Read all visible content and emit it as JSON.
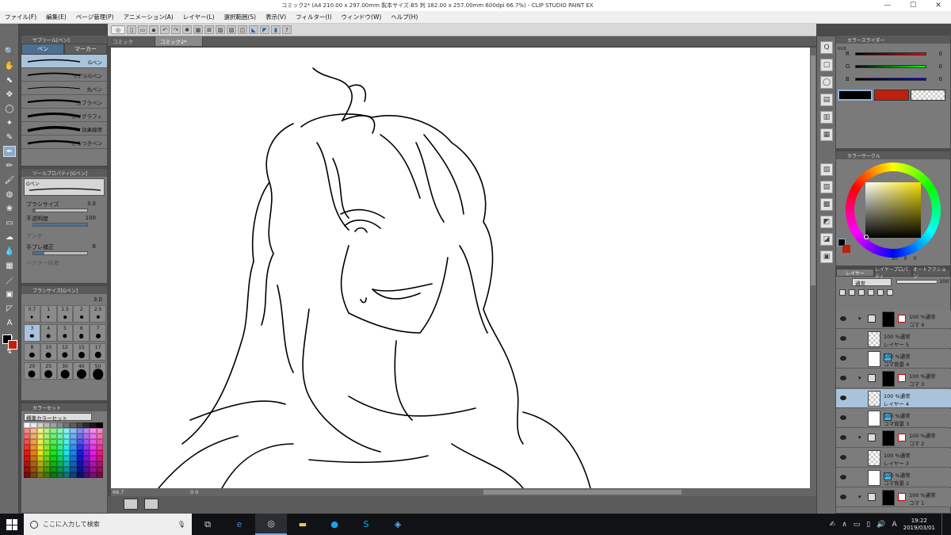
{
  "window": {
    "title": "コミック2* (A4 210.00 x 297.00mm 製本サイズ:B5 判 182.00 x 257.00mm 600dpi 66.7%) - CLIP STUDIO PAINT EX"
  },
  "menu": [
    "ファイル(F)",
    "編集(E)",
    "ページ管理(P)",
    "アニメーション(A)",
    "レイヤー(L)",
    "選択範囲(S)",
    "表示(V)",
    "フィルター(I)",
    "ウィンドウ(W)",
    "ヘルプ(H)"
  ],
  "tabs": [
    "コミック",
    "コミック2*"
  ],
  "subtool": {
    "header": "サブツール[ペン]",
    "tab_pen": "ペン",
    "tab_marker": "マーカー",
    "brushes": [
      "Gペン",
      "リアルGペン",
      "丸ペン",
      "カブラペン",
      "カリグラフィ",
      "効果線用",
      "さらつきペン"
    ]
  },
  "tool_property": {
    "header": "ツールプロパティ[Gペン]",
    "preset": "Gペン",
    "brush_size_label": "ブラシサイズ",
    "brush_size": "3.0",
    "opacity_label": "不透明度",
    "opacity": "100",
    "anti_label": "アンチ",
    "stabilization_label": "手ブレ補正",
    "stabilization": "6",
    "vector_label": "ベクター吸着",
    "brush_size_fraction": 0.04,
    "opacity_fraction": 1.0,
    "stabilization_fraction": 0.2
  },
  "brush_size_panel": {
    "header": "ブラシサイズ[Gペン]",
    "current": "3.0",
    "sizes": [
      "0.7",
      "1",
      "1.5",
      "2",
      "2.5",
      "3",
      "4",
      "5",
      "6",
      "7",
      "8",
      "10",
      "12",
      "15",
      "17",
      "20",
      "25",
      "30",
      "40",
      "50"
    ],
    "selected": "3"
  },
  "color_set": {
    "header": "カラーセット",
    "name": "標準カラーセット"
  },
  "canvas": {
    "zoom": "66.7",
    "angle": "0.0"
  },
  "color_slider": {
    "header": "カラースライダー",
    "tab_rgb": "RGB",
    "r_label": "R",
    "g_label": "G",
    "b_label": "B",
    "r": "0",
    "g": "0",
    "b": "0",
    "main_color": "#000000",
    "sub_color": "#c0200c"
  },
  "color_circle": {
    "header": "カラーサークル",
    "h": "50",
    "s": "0",
    "v": "0"
  },
  "layers": {
    "tab_layer": "レイヤー",
    "tab_property": "レイヤープロパティ",
    "tab_autoaction": "オートアクション",
    "blend_mode": "通常",
    "opacity": "100",
    "items": [
      {
        "mode": "100 %通常",
        "name": "コマ 4",
        "type": "folder"
      },
      {
        "mode": "100 %通常",
        "name": "レイヤー 5",
        "type": "raster"
      },
      {
        "mode": "100 %通常",
        "name": "コマ背景 4",
        "type": "bg"
      },
      {
        "mode": "100 %通常",
        "name": "コマ 3",
        "type": "folder"
      },
      {
        "mode": "100 %通常",
        "name": "レイヤー 4",
        "type": "raster",
        "selected": true
      },
      {
        "mode": "100 %通常",
        "name": "コマ背景 3",
        "type": "bg"
      },
      {
        "mode": "100 %通常",
        "name": "コマ 2",
        "type": "folder"
      },
      {
        "mode": "100 %通常",
        "name": "レイヤー 3",
        "type": "raster"
      },
      {
        "mode": "100 %通常",
        "name": "コマ背景 2",
        "type": "bg"
      },
      {
        "mode": "100 %通常",
        "name": "コマ 1",
        "type": "folder"
      }
    ]
  },
  "taskbar": {
    "search_placeholder": "ここに入力して検索",
    "time": "19:22",
    "date": "2019/03/01",
    "ime": "A"
  },
  "colors": {
    "accent": "#4d6f93",
    "selected": "#a9c3dc",
    "panel": "#7a7a7a",
    "main": "#000000",
    "sub": "#c0200c"
  }
}
